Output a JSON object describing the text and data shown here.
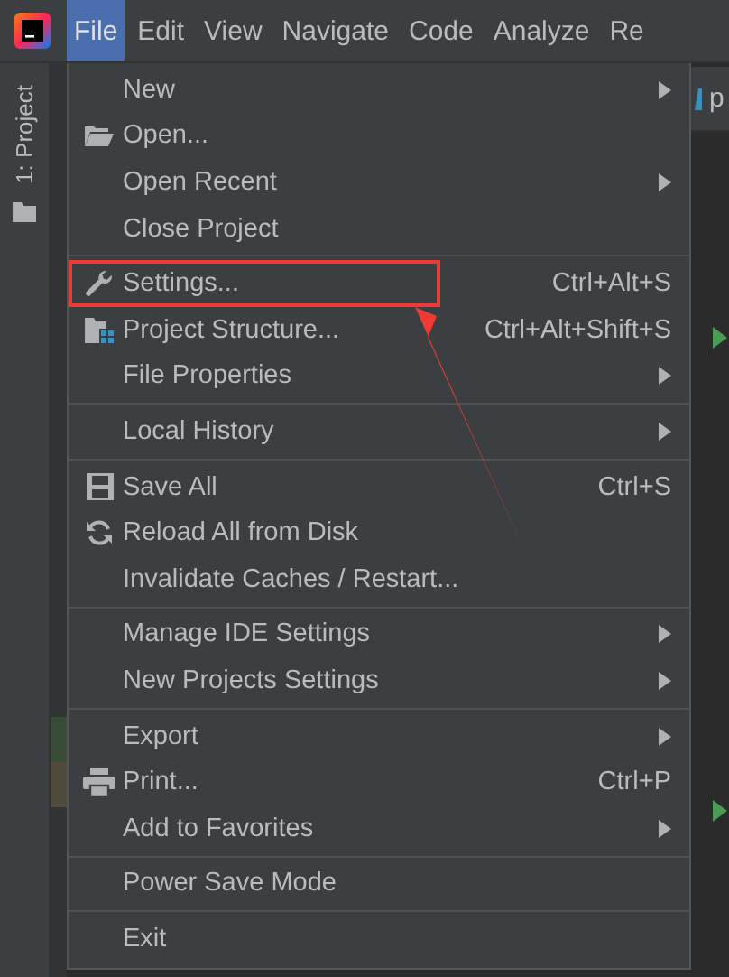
{
  "menubar": [
    {
      "label": "File",
      "selected": true
    },
    {
      "label": "Edit",
      "selected": false
    },
    {
      "label": "View",
      "selected": false
    },
    {
      "label": "Navigate",
      "selected": false
    },
    {
      "label": "Code",
      "selected": false
    },
    {
      "label": "Analyze",
      "selected": false
    },
    {
      "label": "Re",
      "selected": false
    }
  ],
  "tool_strip": {
    "label": "1: Project"
  },
  "editor_tab": {
    "label": "p"
  },
  "menu": {
    "groups": [
      {
        "items": [
          {
            "label": "New",
            "submenu": true,
            "highlighted": false
          },
          {
            "label": "Open...",
            "submenu": false,
            "highlighted": false
          },
          {
            "label": "Open Recent",
            "submenu": true,
            "highlighted": false
          },
          {
            "label": "Close Project",
            "submenu": false,
            "highlighted": false
          }
        ]
      },
      {
        "items": [
          {
            "label": "Settings...",
            "shortcut": "Ctrl+Alt+S",
            "submenu": false,
            "highlighted": true
          },
          {
            "label": "Project Structure...",
            "shortcut": "Ctrl+Alt+Shift+S",
            "submenu": false,
            "highlighted": false
          },
          {
            "label": "File Properties",
            "submenu": true,
            "highlighted": false
          }
        ]
      },
      {
        "items": [
          {
            "label": "Local History",
            "submenu": true,
            "highlighted": false
          }
        ]
      },
      {
        "items": [
          {
            "label": "Save All",
            "shortcut": "Ctrl+S",
            "submenu": false,
            "highlighted": false
          },
          {
            "label": "Reload All from Disk",
            "submenu": false,
            "highlighted": false
          },
          {
            "label": "Invalidate Caches / Restart...",
            "submenu": false,
            "highlighted": false
          }
        ]
      },
      {
        "items": [
          {
            "label": "Manage IDE Settings",
            "submenu": true,
            "highlighted": false
          },
          {
            "label": "New Projects Settings",
            "submenu": true,
            "highlighted": false
          }
        ]
      },
      {
        "items": [
          {
            "label": "Export",
            "submenu": true,
            "highlighted": false
          },
          {
            "label": "Print...",
            "shortcut": "Ctrl+P",
            "submenu": false,
            "highlighted": false
          },
          {
            "label": "Add to Favorites",
            "submenu": true,
            "highlighted": false
          }
        ]
      },
      {
        "items": [
          {
            "label": "Power Save Mode",
            "submenu": false,
            "highlighted": false
          }
        ]
      },
      {
        "items": [
          {
            "label": "Exit",
            "submenu": false,
            "highlighted": false
          }
        ]
      }
    ]
  }
}
